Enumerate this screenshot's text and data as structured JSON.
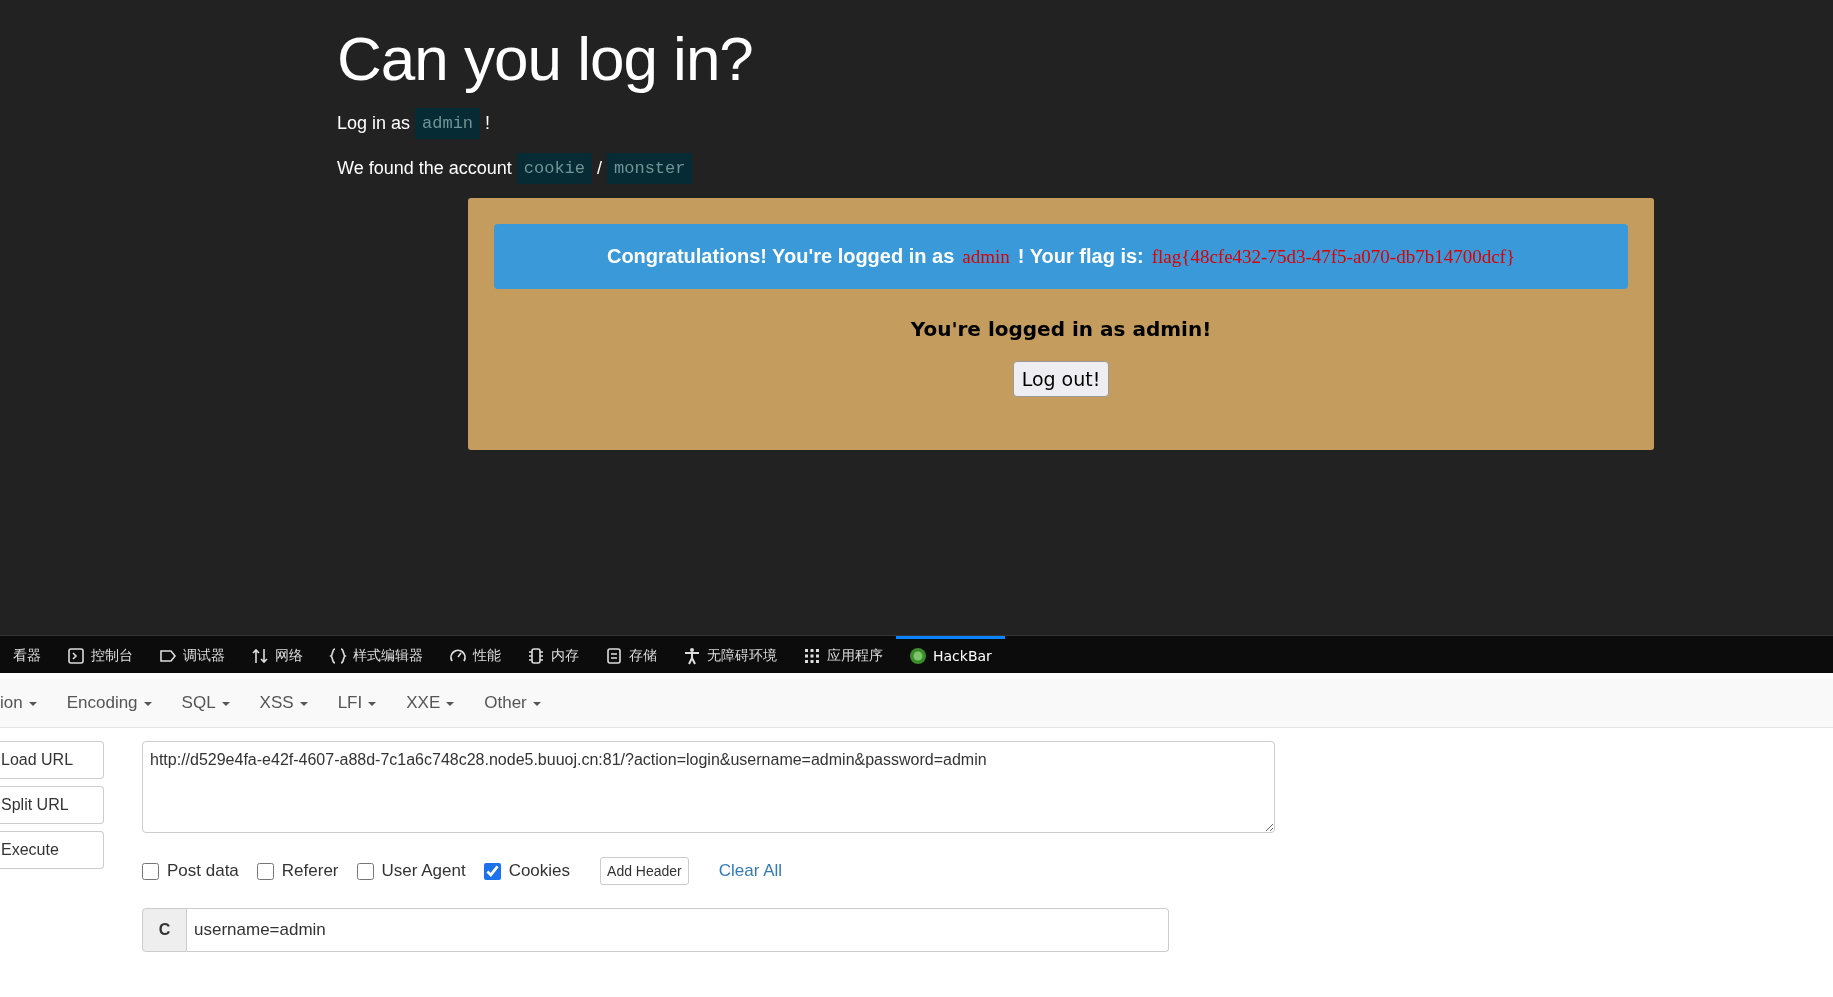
{
  "page": {
    "title": "Can you log in?",
    "login_line": {
      "prefix": "Log in as",
      "user": "admin",
      "suffix": "!"
    },
    "account_line": {
      "prefix": "We found the account",
      "user": "cookie",
      "separator": "/",
      "password": "monster"
    },
    "card": {
      "banner": {
        "before": "Congratulations! You're logged in as",
        "user": "admin",
        "middle": "! Your flag is:",
        "flag": "flag{48cfe432-75d3-47f5-a070-db7b14700dcf}"
      },
      "status": "You're logged in as admin!",
      "logout_button": "Log out!"
    }
  },
  "devtools": {
    "tabs": [
      {
        "label": "看器",
        "selected": false
      },
      {
        "label": "控制台",
        "selected": false
      },
      {
        "label": "调试器",
        "selected": false
      },
      {
        "label": "网络",
        "selected": false
      },
      {
        "label": "样式编辑器",
        "selected": false
      },
      {
        "label": "性能",
        "selected": false
      },
      {
        "label": "内存",
        "selected": false
      },
      {
        "label": "存储",
        "selected": false
      },
      {
        "label": "无障碍环境",
        "selected": false
      },
      {
        "label": "应用程序",
        "selected": false
      },
      {
        "label": "HackBar",
        "selected": true
      }
    ]
  },
  "hackbar": {
    "menus": [
      "ion",
      "Encoding",
      "SQL",
      "XSS",
      "LFI",
      "XXE",
      "Other"
    ],
    "buttons": [
      "Load URL",
      "Split URL",
      "Execute"
    ],
    "url": "http://d529e4fa-e42f-4607-a88d-7c1a6c748c28.node5.buuoj.cn:81/?action=login&username=admin&password=admin",
    "options": [
      {
        "label": "Post data",
        "checked": false
      },
      {
        "label": "Referer",
        "checked": false
      },
      {
        "label": "User Agent",
        "checked": false
      },
      {
        "label": "Cookies",
        "checked": true
      }
    ],
    "add_header": "Add Header",
    "clear_all": "Clear All",
    "header_field": {
      "prefix": "C",
      "value": "username=admin"
    }
  }
}
